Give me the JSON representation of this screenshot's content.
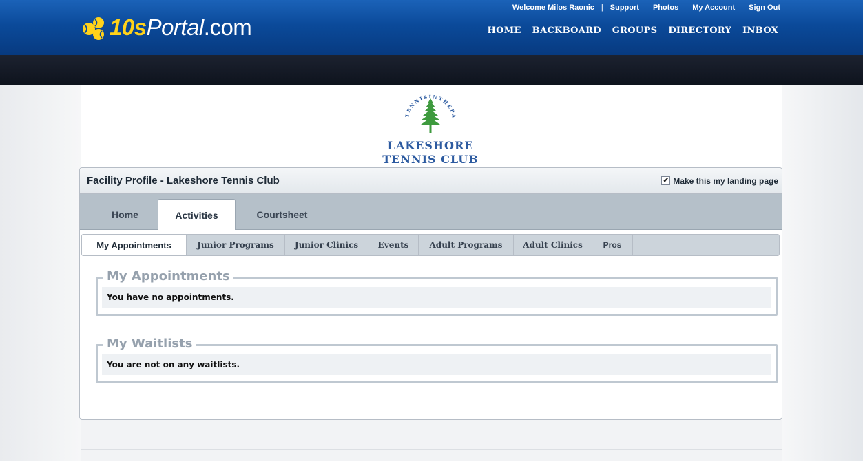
{
  "brand": {
    "logo_bold": "10s",
    "logo_regular": "Portal",
    "logo_suffix": ".com",
    "accent": "#ffd21a",
    "header_blue": "#0b4a9a"
  },
  "utility_nav": {
    "welcome": "Welcome Milos Raonic",
    "separator": "|",
    "support": "Support",
    "photos": "Photos",
    "account": "My Account",
    "signout": "Sign Out"
  },
  "main_nav": [
    "HOME",
    "BACKBOARD",
    "GROUPS",
    "DIRECTORY",
    "INBOX"
  ],
  "club": {
    "ring_text": "TENNISINTHEPARK",
    "name_line1": "LAKESHORE",
    "name_line2": "TENNIS CLUB",
    "green": "#3e9a3e",
    "blue": "#2c5aa0"
  },
  "panel": {
    "title": "Facility Profile - Lakeshore Tennis Club",
    "landing_label": "Make this my landing page",
    "landing_checked": true
  },
  "tabs": [
    "Home",
    "Activities",
    "Courtsheet"
  ],
  "active_tab": "Activities",
  "subtabs": [
    "My Appointments",
    "Junior Programs",
    "Junior Clinics",
    "Events",
    "Adult Programs",
    "Adult Clinics",
    "Pros"
  ],
  "active_subtab": "My Appointments",
  "sections": {
    "appointments": {
      "heading": "My Appointments",
      "message": "You have no appointments."
    },
    "waitlists": {
      "heading": "My Waitlists",
      "message": "You are not on any waitlists."
    }
  },
  "icons": {
    "logo_mark": "tennis-balls-icon",
    "club_tree": "pine-tree-icon",
    "checkbox": "check-icon"
  }
}
